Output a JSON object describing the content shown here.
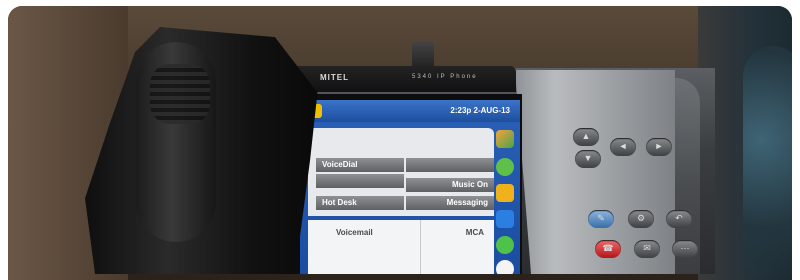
{
  "image": {
    "subject": "desk phone",
    "accent_colors": {
      "screen_blue": "#1f56a9",
      "call_button_red": "#c1161b",
      "call_button_blue": "#4a7fb8"
    }
  },
  "phone": {
    "brand": "MITEL",
    "model": "5340 IP Phone"
  },
  "screen": {
    "status_time": "2:23p 2-AUG-13",
    "keys": {
      "voice_dial": "VoiceDial",
      "music_on": "Music On",
      "hot_desk": "Hot Desk",
      "messaging": "Messaging"
    },
    "bottom": {
      "left": "Voicemail",
      "right": "MCA"
    },
    "side_icons": [
      "contacts-icon",
      "chat-icon",
      "folder-icon",
      "transfer-icon",
      "help-icon",
      "info-icon"
    ]
  },
  "keypad": {
    "glyphs": [
      "▲",
      "▼",
      "◄",
      "►",
      "✎",
      "⚙",
      "↶",
      "☎",
      "✉",
      "⋯"
    ]
  }
}
